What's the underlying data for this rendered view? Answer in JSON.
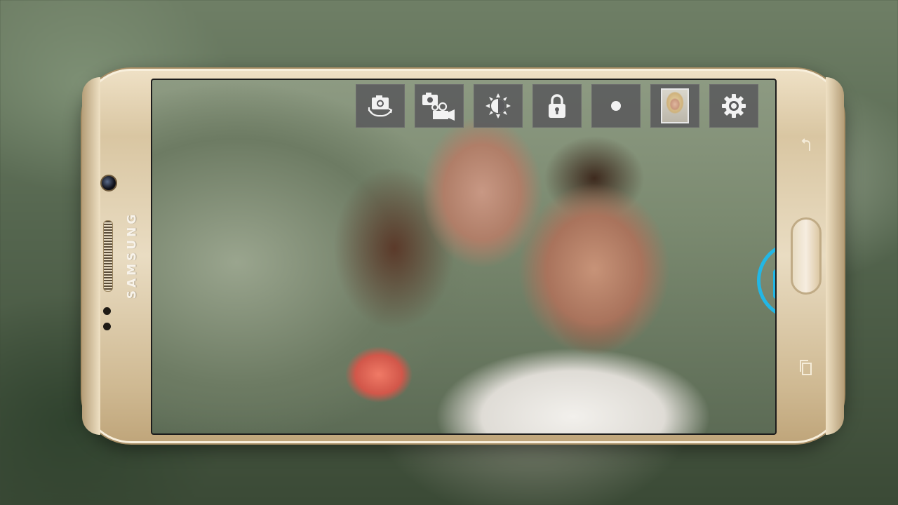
{
  "device": {
    "brand_label": "SAMSUNG"
  },
  "toolbar": {
    "buttons": [
      {
        "id": "switch-camera",
        "icon": "camera-switch-icon"
      },
      {
        "id": "photo-video-mode",
        "icon": "photo-video-icon"
      },
      {
        "id": "brightness",
        "icon": "brightness-icon"
      },
      {
        "id": "lock",
        "icon": "lock-icon"
      },
      {
        "id": "record",
        "icon": "dot-icon"
      },
      {
        "id": "gallery",
        "icon": "gallery-thumbnail"
      },
      {
        "id": "settings",
        "icon": "gear-icon"
      }
    ]
  },
  "shutter": {
    "icon": "camera-icon",
    "accent": "#22b7e5"
  },
  "viewfinder": {
    "subject": "couple-portrait"
  }
}
